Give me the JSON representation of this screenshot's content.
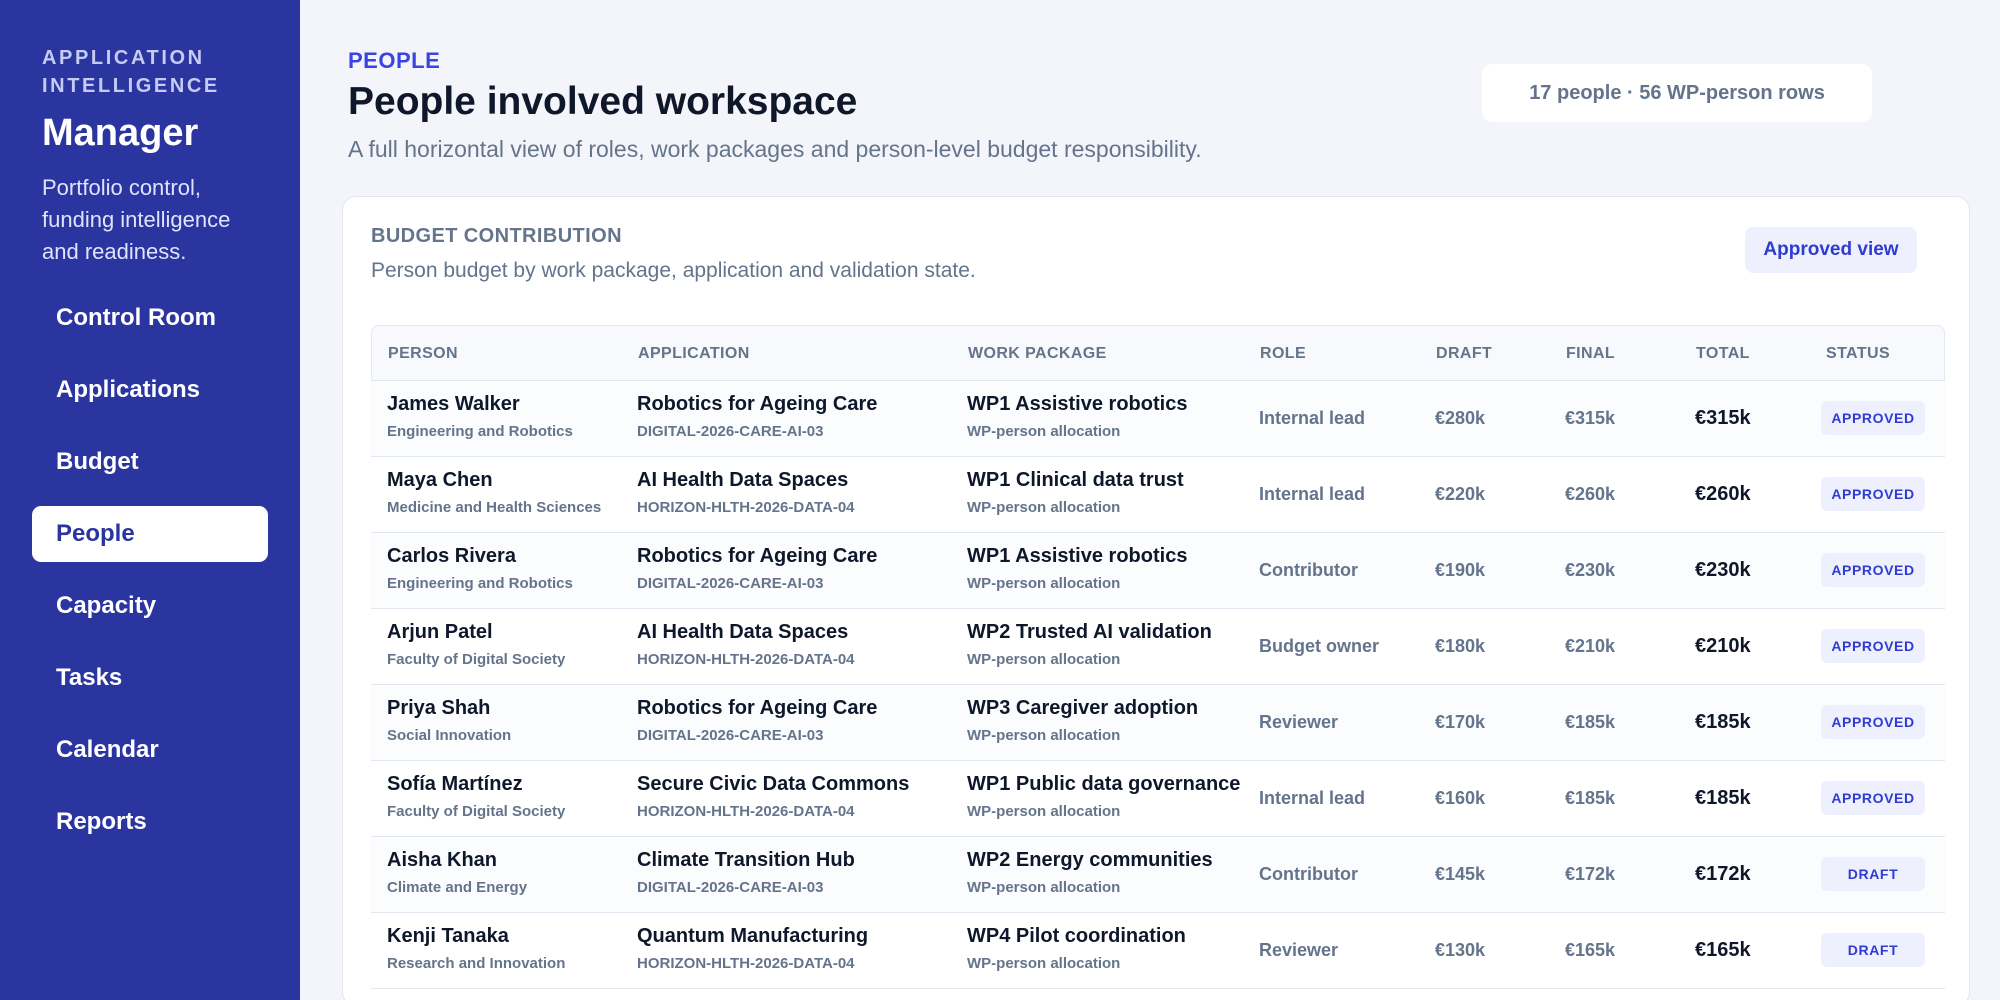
{
  "sidebar": {
    "eyebrow": "APPLICATION INTELLIGENCE",
    "brand": "Manager",
    "tagline": "Portfolio control, funding intelligence and readiness.",
    "nav": [
      {
        "label": "Control Room",
        "active": false
      },
      {
        "label": "Applications",
        "active": false
      },
      {
        "label": "Budget",
        "active": false
      },
      {
        "label": "People",
        "active": true
      },
      {
        "label": "Capacity",
        "active": false
      },
      {
        "label": "Tasks",
        "active": false
      },
      {
        "label": "Calendar",
        "active": false
      },
      {
        "label": "Reports",
        "active": false
      }
    ]
  },
  "header": {
    "kicker": "PEOPLE",
    "title": "People involved workspace",
    "subtitle": "A full horizontal view of roles, work packages and person-level budget responsibility.",
    "count": "17 people · 56 WP-person rows"
  },
  "card": {
    "title": "BUDGET CONTRIBUTION",
    "subtitle": "Person budget by work package, application and validation state.",
    "view_button": "Approved view"
  },
  "table": {
    "columns": [
      "PERSON",
      "APPLICATION",
      "WORK PACKAGE",
      "ROLE",
      "DRAFT",
      "FINAL",
      "TOTAL",
      "STATUS"
    ],
    "rows": [
      {
        "name": "James Walker",
        "dept": "Engineering and Robotics",
        "app": "Robotics for Ageing Care",
        "code": "DIGITAL-2026-CARE-AI-03",
        "wp": "WP1 Assistive robotics",
        "wp_sub": "WP-person allocation",
        "role": "Internal lead",
        "draft": "€280k",
        "final": "€315k",
        "total": "€315k",
        "status": "APPROVED"
      },
      {
        "name": "Maya Chen",
        "dept": "Medicine and Health Sciences",
        "app": "AI Health Data Spaces",
        "code": "HORIZON-HLTH-2026-DATA-04",
        "wp": "WP1 Clinical data trust",
        "wp_sub": "WP-person allocation",
        "role": "Internal lead",
        "draft": "€220k",
        "final": "€260k",
        "total": "€260k",
        "status": "APPROVED"
      },
      {
        "name": "Carlos Rivera",
        "dept": "Engineering and Robotics",
        "app": "Robotics for Ageing Care",
        "code": "DIGITAL-2026-CARE-AI-03",
        "wp": "WP1 Assistive robotics",
        "wp_sub": "WP-person allocation",
        "role": "Contributor",
        "draft": "€190k",
        "final": "€230k",
        "total": "€230k",
        "status": "APPROVED"
      },
      {
        "name": "Arjun Patel",
        "dept": "Faculty of Digital Society",
        "app": "AI Health Data Spaces",
        "code": "HORIZON-HLTH-2026-DATA-04",
        "wp": "WP2 Trusted AI validation",
        "wp_sub": "WP-person allocation",
        "role": "Budget owner",
        "draft": "€180k",
        "final": "€210k",
        "total": "€210k",
        "status": "APPROVED"
      },
      {
        "name": "Priya Shah",
        "dept": "Social Innovation",
        "app": "Robotics for Ageing Care",
        "code": "DIGITAL-2026-CARE-AI-03",
        "wp": "WP3 Caregiver adoption",
        "wp_sub": "WP-person allocation",
        "role": "Reviewer",
        "draft": "€170k",
        "final": "€185k",
        "total": "€185k",
        "status": "APPROVED"
      },
      {
        "name": "Sofía Martínez",
        "dept": "Faculty of Digital Society",
        "app": "Secure Civic Data Commons",
        "code": "HORIZON-HLTH-2026-DATA-04",
        "wp": "WP1 Public data governance",
        "wp_sub": "WP-person allocation",
        "role": "Internal lead",
        "draft": "€160k",
        "final": "€185k",
        "total": "€185k",
        "status": "APPROVED"
      },
      {
        "name": "Aisha Khan",
        "dept": "Climate and Energy",
        "app": "Climate Transition Hub",
        "code": "DIGITAL-2026-CARE-AI-03",
        "wp": "WP2 Energy communities",
        "wp_sub": "WP-person allocation",
        "role": "Contributor",
        "draft": "€145k",
        "final": "€172k",
        "total": "€172k",
        "status": "DRAFT"
      },
      {
        "name": "Kenji Tanaka",
        "dept": "Research and Innovation",
        "app": "Quantum Manufacturing",
        "code": "HORIZON-HLTH-2026-DATA-04",
        "wp": "WP4 Pilot coordination",
        "wp_sub": "WP-person allocation",
        "role": "Reviewer",
        "draft": "€130k",
        "final": "€165k",
        "total": "€165k",
        "status": "DRAFT"
      }
    ]
  }
}
